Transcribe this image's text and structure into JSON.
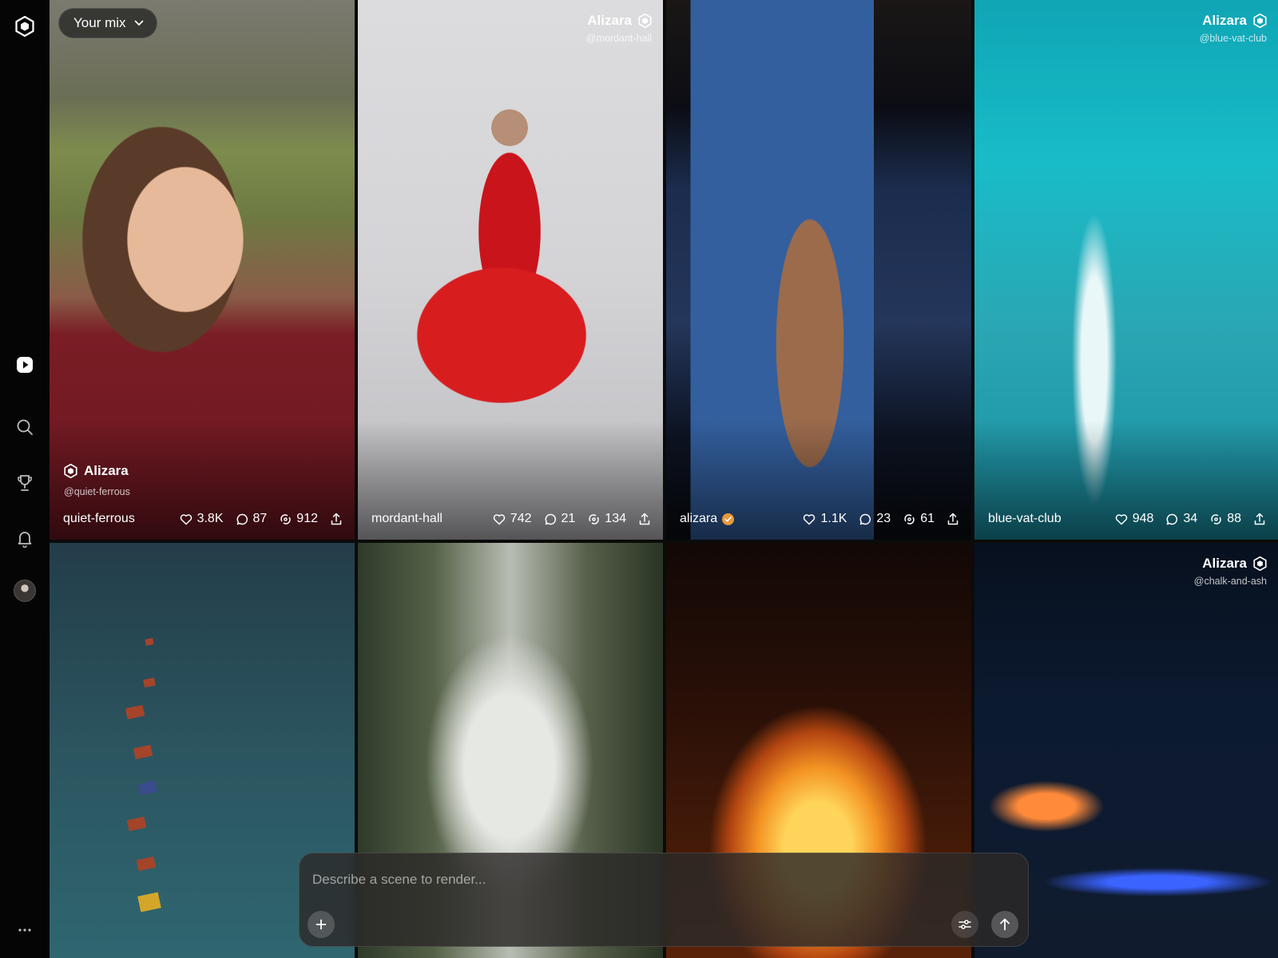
{
  "mix": {
    "label": "Your mix"
  },
  "composer": {
    "placeholder": "Describe a scene to render..."
  },
  "colors": {
    "verified": "#e89a3b",
    "sidebar_bg": "#050505"
  },
  "sidebar": {
    "items": [
      {
        "name": "logo",
        "icon": "hexagon-logo-icon"
      },
      {
        "name": "feed",
        "icon": "play-icon"
      },
      {
        "name": "search",
        "icon": "search-icon"
      },
      {
        "name": "leaderboard",
        "icon": "trophy-icon"
      },
      {
        "name": "notifications",
        "icon": "bell-icon"
      },
      {
        "name": "profile",
        "icon": "avatar"
      },
      {
        "name": "more",
        "icon": "more-icon"
      }
    ]
  },
  "tiles": [
    {
      "creator": "Alizara",
      "handle": "@quiet-ferrous",
      "creator_position": "bottom-left",
      "user": "quiet-ferrous",
      "verified": false,
      "likes": "3.8K",
      "comments": "87",
      "remixes": "912"
    },
    {
      "creator": "Alizara",
      "handle": "@mordant-hall",
      "creator_position": "top-right",
      "user": "mordant-hall",
      "verified": false,
      "likes": "742",
      "comments": "21",
      "remixes": "134"
    },
    {
      "user": "alizara",
      "verified": true,
      "likes": "1.1K",
      "comments": "23",
      "remixes": "61"
    },
    {
      "creator": "Alizara",
      "handle": "@blue-vat-club",
      "creator_position": "top-right",
      "user": "blue-vat-club",
      "verified": false,
      "likes": "948",
      "comments": "34",
      "remixes": "88"
    },
    {},
    {},
    {},
    {
      "creator": "Alizara",
      "handle": "@chalk-and-ash",
      "creator_position": "top-right"
    }
  ]
}
